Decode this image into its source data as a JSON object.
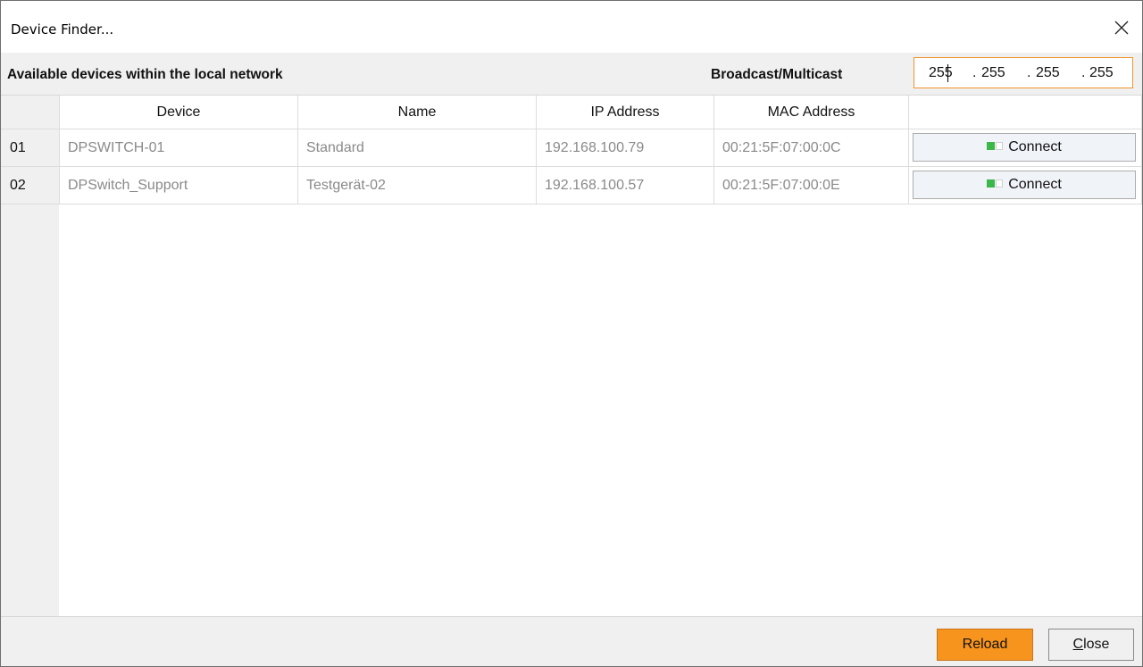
{
  "window": {
    "title": "Device Finder...",
    "close_icon": "close-icon"
  },
  "topbar": {
    "heading": "Available devices within the local network",
    "broadcast_label": "Broadcast/Multicast",
    "ip": {
      "octets": [
        "255",
        "255",
        "255",
        "255"
      ],
      "separator": "."
    }
  },
  "table": {
    "headers": [
      "Device",
      "Name",
      "IP Address",
      "MAC Address",
      ""
    ],
    "rows": [
      {
        "num": "01",
        "device": "DPSWITCH-01",
        "name": "Standard",
        "ip": "192.168.100.79",
        "mac": "00:21:5F:07:00:0C",
        "action": "Connect",
        "status_icon": "connection-indicator-icon"
      },
      {
        "num": "02",
        "device": "DPSwitch_Support",
        "name": "Testgerät-02",
        "ip": "192.168.100.57",
        "mac": "00:21:5F:07:00:0E",
        "action": "Connect",
        "status_icon": "connection-indicator-icon"
      }
    ]
  },
  "footer": {
    "reload": "Reload",
    "close_first": "C",
    "close_rest": "lose"
  },
  "colors": {
    "accent": "#f7941d",
    "field_border": "#f0932b",
    "indicator": "#3cb84a"
  }
}
